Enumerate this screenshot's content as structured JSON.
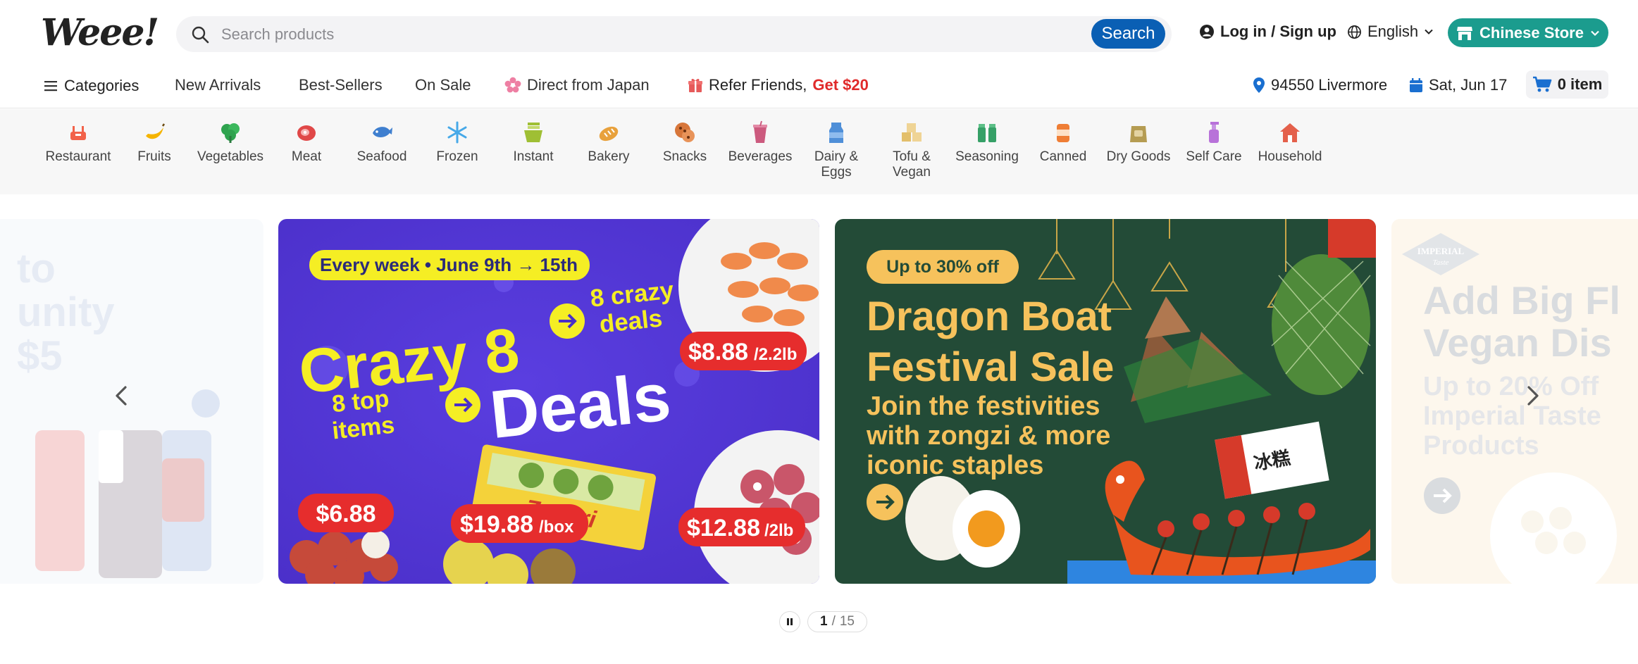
{
  "header": {
    "logo_text": "Weee!",
    "search_placeholder": "Search products",
    "search_button": "Search",
    "login_label": "Log in / Sign up",
    "language": "English",
    "store_switch": "Chinese Store"
  },
  "nav": {
    "categories": "Categories",
    "new_arrivals": "New Arrivals",
    "best_sellers": "Best-Sellers",
    "on_sale": "On Sale",
    "direct_japan": "Direct from Japan",
    "refer_prefix": "Refer Friends,",
    "refer_highlight": "Get $20",
    "location": "94550 Livermore",
    "delivery_date": "Sat, Jun 17",
    "cart": "0 item"
  },
  "categories": [
    {
      "label": "Restaurant",
      "icon": "restaurant-icon",
      "color": "#f2624a"
    },
    {
      "label": "Fruits",
      "icon": "banana-icon",
      "color": "#f5b400"
    },
    {
      "label": "Vegetables",
      "icon": "vegetable-icon",
      "color": "#2fa34f"
    },
    {
      "label": "Meat",
      "icon": "meat-icon",
      "color": "#e04848"
    },
    {
      "label": "Seafood",
      "icon": "fish-icon",
      "color": "#3f7fcf"
    },
    {
      "label": "Frozen",
      "icon": "snowflake-icon",
      "color": "#47a9e8"
    },
    {
      "label": "Instant",
      "icon": "noodle-icon",
      "color": "#9fbf34"
    },
    {
      "label": "Bakery",
      "icon": "bread-icon",
      "color": "#e8a13c"
    },
    {
      "label": "Snacks",
      "icon": "cookie-icon",
      "color": "#d7763a"
    },
    {
      "label": "Beverages",
      "icon": "drink-icon",
      "color": "#cc5a7e"
    },
    {
      "label": "Dairy & Eggs",
      "icon": "milk-icon",
      "color": "#4f8fd8"
    },
    {
      "label": "Tofu & Vegan",
      "icon": "tofu-icon",
      "color": "#e3bf6b"
    },
    {
      "label": "Seasoning",
      "icon": "spice-icon",
      "color": "#36a067"
    },
    {
      "label": "Canned",
      "icon": "can-icon",
      "color": "#ef7e35"
    },
    {
      "label": "Dry Goods",
      "icon": "bag-icon",
      "color": "#b59c52"
    },
    {
      "label": "Self Care",
      "icon": "bottle-icon",
      "color": "#b872d9"
    },
    {
      "label": "Household",
      "icon": "house-icon",
      "color": "#e4604b"
    }
  ],
  "banners": {
    "left_fragment_lines": [
      "to",
      "unity",
      "$5"
    ],
    "crazy8": {
      "week_badge": "Every week • June 9th → 15th",
      "title_a": "Crazy 8",
      "subtitle_a": "8 crazy deals",
      "subtitle_b": "8 top items",
      "title_b": "Deals",
      "price_shrimp": "$8.88",
      "price_shrimp_unit": "/2.2lb",
      "price_lychee": "$6.88",
      "price_kiwi": "$19.88",
      "price_kiwi_unit": "/box",
      "price_meat": "$12.88",
      "price_meat_unit": "/2lb",
      "brand": "Zespri"
    },
    "dragon": {
      "badge": "Up to 30% off",
      "title_l1": "Dragon Boat",
      "title_l2": "Festival Sale",
      "body_l1": "Join the festivities",
      "body_l2": "with zongzi & more",
      "body_l3": "iconic staples",
      "package_text": "冰糕"
    },
    "right": {
      "logo_text": "IMPERIAL",
      "logo_sub": "Taste",
      "title_l1": "Add Big Fl",
      "title_l2": "Vegan Dis",
      "body_l1": "Up to 20% Off",
      "body_l2": "Imperial Taste",
      "body_l3": "Products"
    }
  },
  "pager": {
    "current": "1",
    "sep": "/",
    "total": "15"
  },
  "colors": {
    "brand_blue": "#0a5fb4",
    "store_green": "#1b9c8e",
    "refer_red": "#e02a2a",
    "crazy8_purple": "#5a3ee0",
    "crazy8_yellow": "#f5ee24",
    "dragon_green": "#234b37",
    "dragon_gold": "#f6c25c"
  }
}
